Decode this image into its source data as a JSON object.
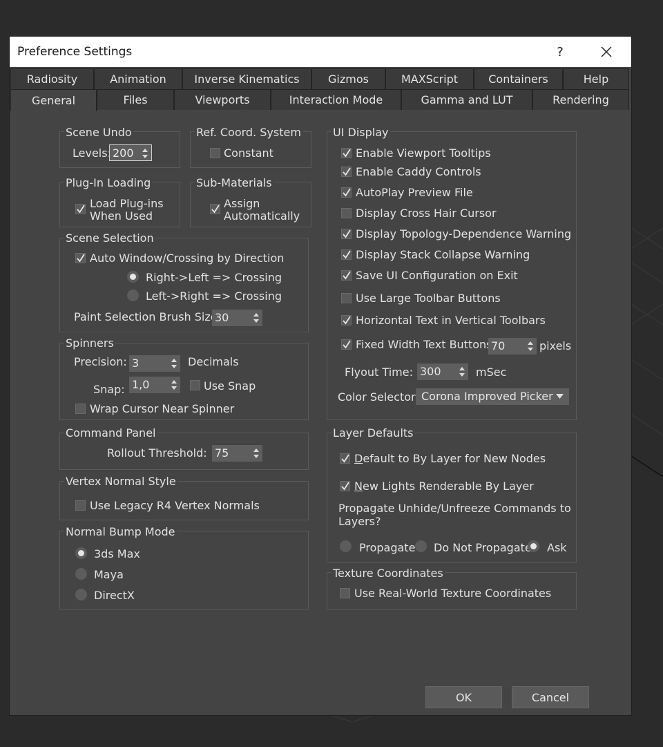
{
  "window": {
    "title": "Preference Settings",
    "help": "?"
  },
  "tabs_row1": [
    "Radiosity",
    "Animation",
    "Inverse Kinematics",
    "Gizmos",
    "MAXScript",
    "Containers",
    "Help"
  ],
  "tabs_row2": [
    "General",
    "Files",
    "Viewports",
    "Interaction Mode",
    "Gamma and LUT",
    "Rendering"
  ],
  "scene_undo": {
    "title": "Scene Undo",
    "levels_label": "Levels:",
    "levels_value": "200"
  },
  "ref_coord": {
    "title": "Ref. Coord. System",
    "constant_label": "Constant",
    "constant_checked": false
  },
  "plugin_loading": {
    "title": "Plug-In Loading",
    "line1": "Load Plug-ins",
    "line2": "When Used",
    "checked": true
  },
  "sub_materials": {
    "title": "Sub-Materials",
    "line1": "Assign",
    "line2": "Automatically",
    "checked": true
  },
  "scene_selection": {
    "title": "Scene Selection",
    "auto_window": "Auto Window/Crossing by Direction",
    "auto_window_checked": true,
    "right_left": "Right->Left => Crossing",
    "left_right": "Left->Right => Crossing",
    "selected": "right_left",
    "brush_label": "Paint Selection Brush Size",
    "brush_value": "30"
  },
  "spinners": {
    "title": "Spinners",
    "precision_label": "Precision:",
    "precision_value": "3",
    "decimals_label": "Decimals",
    "snap_label": "Snap:",
    "snap_value": "1,0",
    "use_snap_label": "Use Snap",
    "use_snap_checked": false,
    "wrap_label": "Wrap Cursor Near Spinner",
    "wrap_checked": false
  },
  "command_panel": {
    "title": "Command Panel",
    "rollout_label": "Rollout Threshold:",
    "rollout_value": "75"
  },
  "vertex_normal": {
    "title": "Vertex Normal Style",
    "legacy_label": "Use Legacy R4 Vertex Normals",
    "legacy_checked": false
  },
  "normal_bump": {
    "title": "Normal Bump Mode",
    "options": [
      "3ds Max",
      "Maya",
      "DirectX"
    ],
    "selected": 0
  },
  "ui_display": {
    "title": "UI Display",
    "items": [
      {
        "label": "Enable Viewport Tooltips",
        "checked": true
      },
      {
        "label": "Enable Caddy Controls",
        "checked": true
      },
      {
        "label": "AutoPlay Preview File",
        "checked": true
      },
      {
        "label": "Display Cross Hair Cursor",
        "checked": false
      },
      {
        "label": "Display Topology-Dependence Warning",
        "checked": true
      },
      {
        "label": "Display Stack Collapse Warning",
        "checked": true
      },
      {
        "label": "Save UI Configuration on Exit",
        "checked": true
      },
      {
        "label": "Use Large Toolbar Buttons",
        "checked": false
      },
      {
        "label": "Horizontal Text in Vertical Toolbars",
        "checked": true
      }
    ],
    "fixed_width_label": "Fixed Width Text Buttons:",
    "fixed_width_checked": true,
    "fixed_width_value": "70",
    "pixels_label": "pixels",
    "flyout_label": "Flyout Time:",
    "flyout_value": "300",
    "msec_label": "mSec",
    "color_selector_label": "Color Selector:",
    "color_selector_value": "Corona Improved Picker"
  },
  "layer_defaults": {
    "title": "Layer Defaults",
    "default_bylayer_prefix": "D",
    "default_bylayer_rest": "efault to By Layer for New Nodes",
    "default_bylayer_checked": true,
    "lights_prefix": "N",
    "lights_rest": "ew Lights Renderable By Layer",
    "lights_checked": true,
    "propagate_question_1": "Propagate Unhide/Unfreeze Commands to",
    "propagate_question_2": "Layers?",
    "options": [
      "Propagate",
      "Do Not Propagate",
      "Ask"
    ],
    "selected": 2
  },
  "texture_coords": {
    "title": "Texture Coordinates",
    "real_world_label": "Use Real-World Texture Coordinates",
    "real_world_checked": false
  },
  "buttons": {
    "ok": "OK",
    "cancel": "Cancel"
  }
}
